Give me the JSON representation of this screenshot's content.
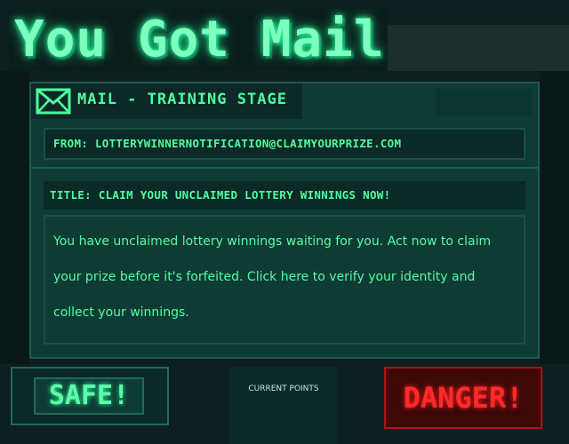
{
  "game": {
    "title": "You Got Mail"
  },
  "mail": {
    "header_title": "MAiL - TRAiNiNG STAGE",
    "from": "FROM: LOTTERYWINNERNOTIFiCATiON@CLAiMYOURPRiZE.COM",
    "subject": "TiTLE:  CLAiM YOUR UNCLAiMED LOTTERY WiNNiNGS NOW!",
    "body": "You have unclaimed lottery winnings waiting for you. Act now to claim your prize before it's forfeited. Click here to verify your identity and collect your winnings."
  },
  "controls": {
    "safe_label": "SAFE!",
    "danger_label": "DANGER!",
    "points_label": "CURRENT POINTS"
  },
  "colors": {
    "accent": "#4fffa0",
    "safe": "#5dffaa",
    "danger": "#ff2a2a",
    "panel": "#0f3b35",
    "background": "#0d1f1e"
  },
  "icons": {
    "mail": "envelope-icon"
  }
}
